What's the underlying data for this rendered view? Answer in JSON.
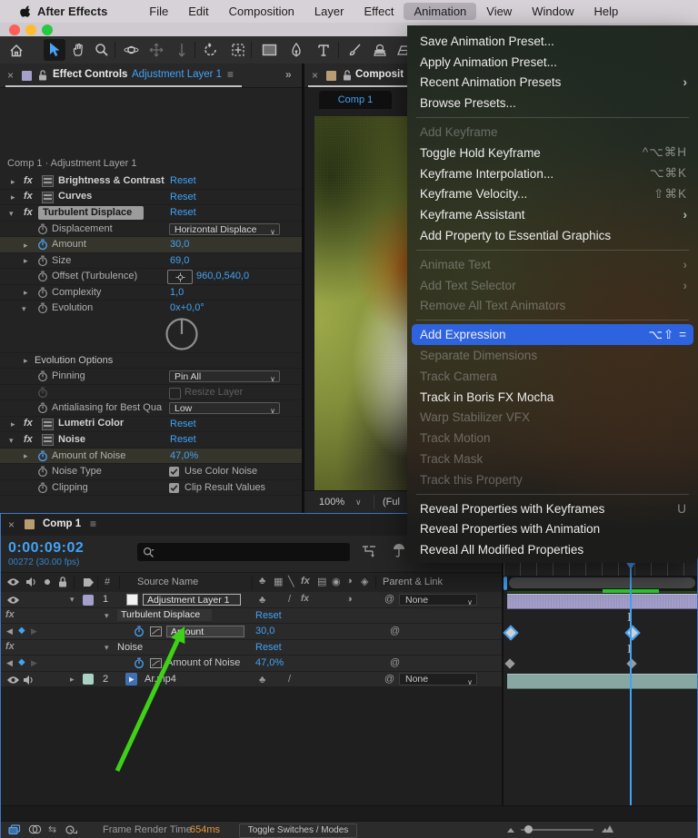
{
  "colors": {
    "accent_blue": "#42a2f5",
    "menu_highlight": "#2e63e0",
    "render_green": "#2bd12b",
    "arrow_green": "#3fd117",
    "warning_orange": "#e8963c",
    "label_lavender": "#a4a0cb",
    "label_teal": "#87a8a2",
    "swatch_tan": "#b79e72",
    "swatch_mint": "#abd3c5"
  },
  "glyphs": {
    "close": "×",
    "panel_menu": "≡",
    "overflow": "»",
    "twirl_open": "▾",
    "twirl_closed": "▸",
    "caret": "∨",
    "submenu": "›",
    "kf_prev": "◀",
    "kf_next": "▶",
    "kf_diamond": "◆",
    "fx": "fx",
    "pickwhip": "@",
    "quality": "/",
    "shy": "♣",
    "frame_blend": "▦",
    "motion_blur": "╲",
    "adj": "▤",
    "circle": "◉",
    "half": "◑",
    "cube": "◈",
    "dot": "·"
  },
  "menubar": {
    "items": [
      "After Effects",
      "File",
      "Edit",
      "Composition",
      "Layer",
      "Effect",
      "Animation",
      "View",
      "Window",
      "Help"
    ]
  },
  "effect_controls": {
    "tab": {
      "title": "Effect Controls",
      "layer_name": "Adjustment Layer 1"
    },
    "breadcrumb": "Comp 1 · Adjustment Layer 1",
    "effects": [
      {
        "name": "Brightness & Contrast",
        "action": "Reset"
      },
      {
        "name": "Curves",
        "action": "Reset"
      },
      {
        "name": "Turbulent Displace",
        "action": "Reset"
      },
      {
        "name": "Lumetri Color",
        "action": "Reset"
      },
      {
        "name": "Noise",
        "action": "Reset"
      }
    ],
    "properties": {
      "displacement": {
        "label": "Displacement",
        "value": "Horizontal Displace"
      },
      "amount": {
        "label": "Amount",
        "value": "30,0"
      },
      "size": {
        "label": "Size",
        "value": "69,0"
      },
      "offset": {
        "label": "Offset (Turbulence)",
        "value": "960,0,540,0"
      },
      "complexity": {
        "label": "Complexity",
        "value": "1,0"
      },
      "evolution": {
        "label": "Evolution",
        "value": "0x+0,0°"
      },
      "evolution_options": {
        "label": "Evolution Options"
      },
      "pinning": {
        "label": "Pinning",
        "value": "Pin All"
      },
      "resize_layer": {
        "label": "Resize Layer"
      },
      "antialiasing": {
        "label": "Antialiasing for Best Qua",
        "value": "Low"
      },
      "amount_of_noise": {
        "label": "Amount of Noise",
        "value": "47,0%"
      },
      "noise_type": {
        "label": "Noise Type",
        "value": "Use Color Noise"
      },
      "clipping": {
        "label": "Clipping",
        "value": "Clip Result Values"
      }
    }
  },
  "composition": {
    "tab_title": "Composit",
    "comp_tab": "Comp 1",
    "footer": {
      "zoom": "100%",
      "resolution": "(Ful"
    }
  },
  "animation_menu": {
    "items": [
      {
        "label": "Save Animation Preset...",
        "shortcut": "",
        "state": "normal",
        "submenu": false
      },
      {
        "label": "Apply Animation Preset...",
        "shortcut": "",
        "state": "normal",
        "submenu": false
      },
      {
        "label": "Recent Animation Presets",
        "shortcut": "",
        "state": "normal",
        "submenu": true
      },
      {
        "label": "Browse Presets...",
        "shortcut": "",
        "state": "normal",
        "submenu": false
      },
      {
        "label": "Add Keyframe",
        "shortcut": "",
        "state": "disabled",
        "submenu": false
      },
      {
        "label": "Toggle Hold Keyframe",
        "shortcut": "^⌥⌘H",
        "state": "normal",
        "submenu": false
      },
      {
        "label": "Keyframe Interpolation...",
        "shortcut": "⌥⌘K",
        "state": "normal",
        "submenu": false
      },
      {
        "label": "Keyframe Velocity...",
        "shortcut": "⇧⌘K",
        "state": "normal",
        "submenu": false
      },
      {
        "label": "Keyframe Assistant",
        "shortcut": "",
        "state": "normal",
        "submenu": true
      },
      {
        "label": "Add Property to Essential Graphics",
        "shortcut": "",
        "state": "normal",
        "submenu": false
      },
      {
        "label": "Animate Text",
        "shortcut": "",
        "state": "disabled",
        "submenu": true
      },
      {
        "label": "Add Text Selector",
        "shortcut": "",
        "state": "disabled",
        "submenu": true
      },
      {
        "label": "Remove All Text Animators",
        "shortcut": "",
        "state": "disabled",
        "submenu": false
      },
      {
        "label": "Add Expression",
        "shortcut": "⌥⇧ =",
        "state": "selected",
        "submenu": false
      },
      {
        "label": "Separate Dimensions",
        "shortcut": "",
        "state": "disabled",
        "submenu": false
      },
      {
        "label": "Track Camera",
        "shortcut": "",
        "state": "disabled",
        "submenu": false
      },
      {
        "label": "Track in Boris FX Mocha",
        "shortcut": "",
        "state": "normal",
        "submenu": false
      },
      {
        "label": "Warp Stabilizer VFX",
        "shortcut": "",
        "state": "disabled",
        "submenu": false
      },
      {
        "label": "Track Motion",
        "shortcut": "",
        "state": "disabled",
        "submenu": false
      },
      {
        "label": "Track Mask",
        "shortcut": "",
        "state": "disabled",
        "submenu": false
      },
      {
        "label": "Track this Property",
        "shortcut": "",
        "state": "disabled",
        "submenu": false
      },
      {
        "label": "Reveal Properties with Keyframes",
        "shortcut": "U",
        "state": "normal",
        "submenu": false
      },
      {
        "label": "Reveal Properties with Animation",
        "shortcut": "",
        "state": "normal",
        "submenu": false
      },
      {
        "label": "Reveal All Modified Properties",
        "shortcut": "",
        "state": "normal",
        "submenu": false
      }
    ]
  },
  "timeline": {
    "tab": "Comp 1",
    "timecode": "0:00:09:02",
    "frame_info": "00272 (30.00 fps)",
    "columns": {
      "hash": "#",
      "source_name": "Source Name",
      "parent_link": "Parent & Link"
    },
    "rows": [
      {
        "index": "1",
        "name": "Adjustment Layer 1",
        "parent": "None"
      },
      {
        "name": "Turbulent Displace",
        "value": "Reset"
      },
      {
        "name": "Amount",
        "value": "30,0"
      },
      {
        "name": "Noise",
        "value": "Reset"
      },
      {
        "name": "Amount of Noise",
        "value": "47,0%"
      },
      {
        "index": "2",
        "name": "Ar.mp4",
        "parent": "None"
      }
    ],
    "footer": {
      "frame_render_label": "Frame Render Time",
      "frame_render_value": "654ms",
      "toggle_modes": "Toggle Switches / Modes"
    }
  }
}
